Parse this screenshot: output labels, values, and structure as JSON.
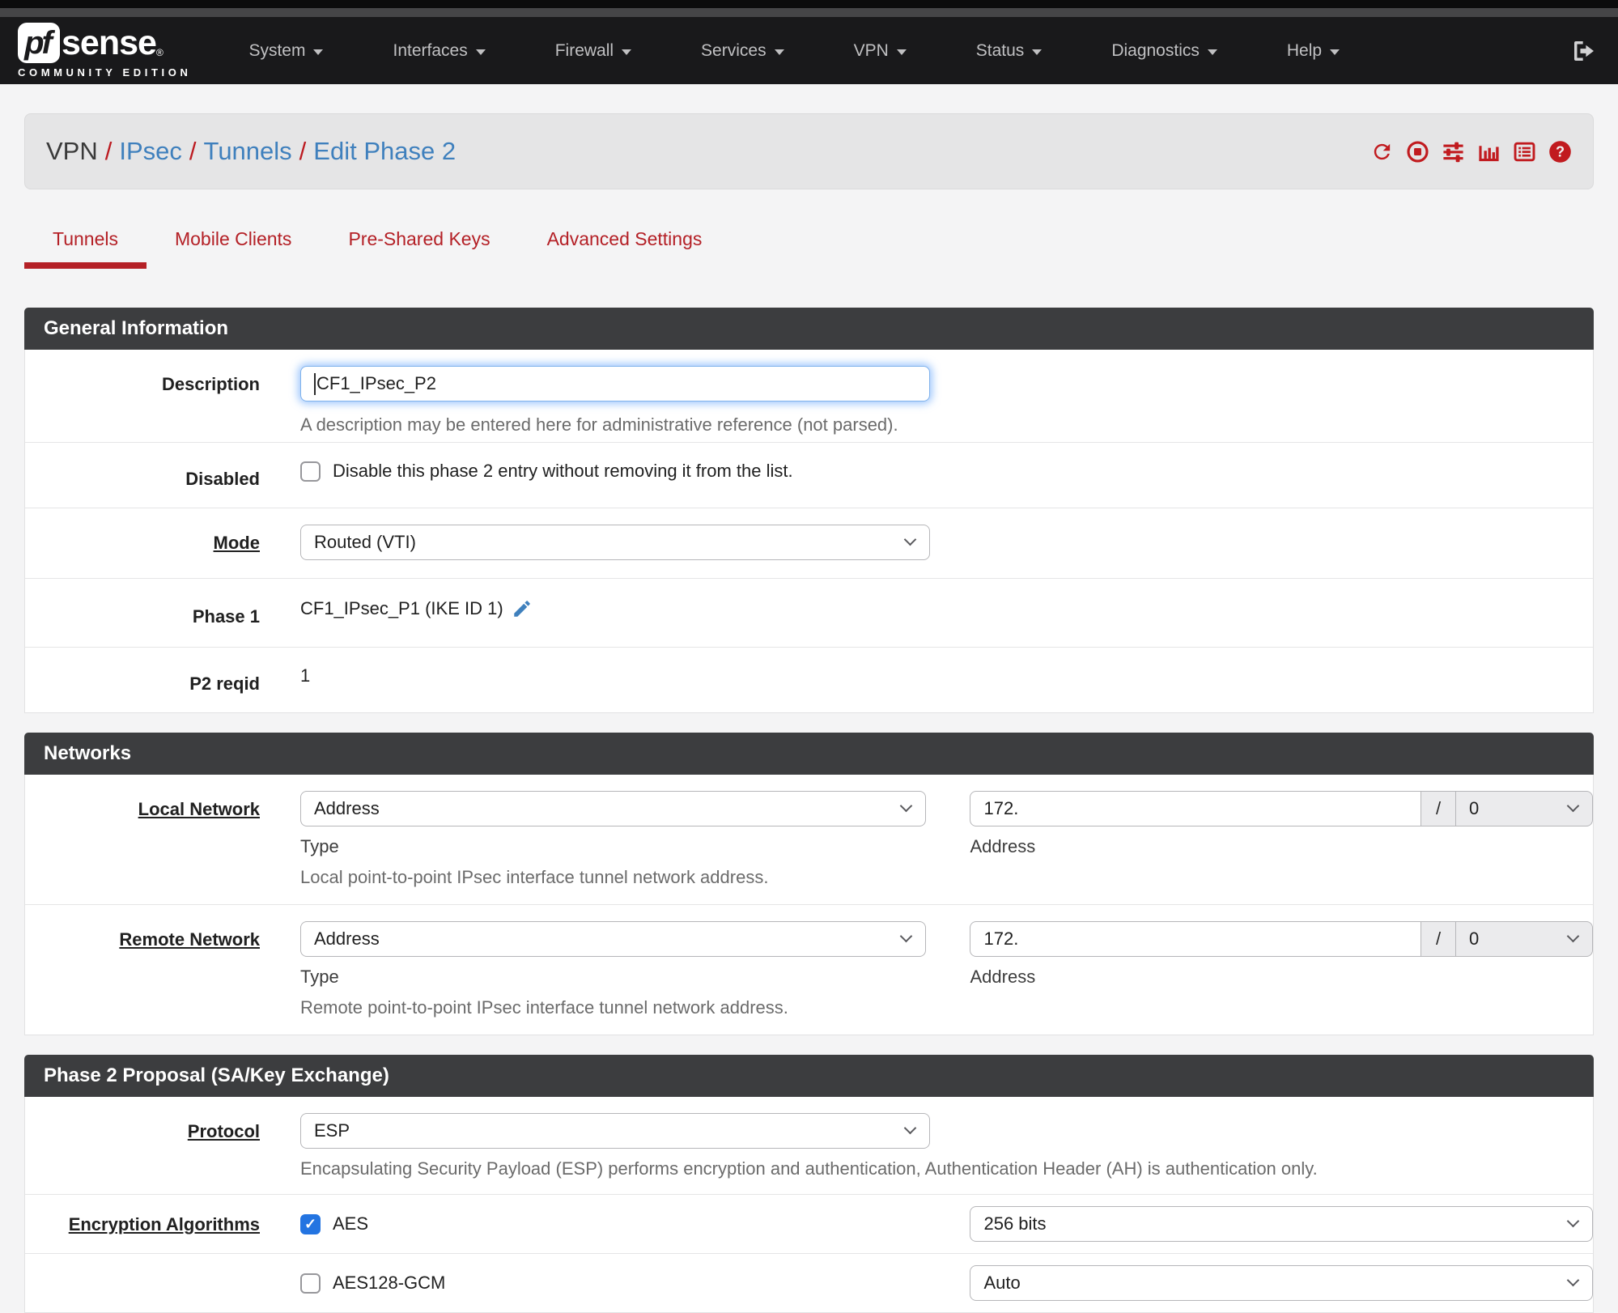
{
  "brand": {
    "logo_pf": "pf",
    "logo_rest": "sense",
    "registered": "®",
    "edition": "COMMUNITY EDITION"
  },
  "navbar": {
    "items": [
      {
        "label": "System"
      },
      {
        "label": "Interfaces"
      },
      {
        "label": "Firewall"
      },
      {
        "label": "Services"
      },
      {
        "label": "VPN"
      },
      {
        "label": "Status"
      },
      {
        "label": "Diagnostics"
      },
      {
        "label": "Help"
      }
    ]
  },
  "breadcrumb": {
    "root": "VPN",
    "separator": "/",
    "link1": "IPsec",
    "link2": "Tunnels",
    "link3": "Edit Phase 2"
  },
  "header_actions": [
    "refresh-icon",
    "stop-circle-icon",
    "sliders-icon",
    "bar-chart-icon",
    "list-icon",
    "question-circle-icon"
  ],
  "tabs": [
    {
      "label": "Tunnels",
      "active": true
    },
    {
      "label": "Mobile Clients",
      "active": false
    },
    {
      "label": "Pre-Shared Keys",
      "active": false
    },
    {
      "label": "Advanced Settings",
      "active": false
    }
  ],
  "colors": {
    "accent_red": "#bc1a20",
    "link_blue": "#3f80bd",
    "panel_header_bg": "#3c3d3f",
    "navbar_bg": "#19191b",
    "checkbox_checked_blue": "#2374e1"
  },
  "general": {
    "title": "General Information",
    "description": {
      "label": "Description",
      "value": "CF1_IPsec_P2",
      "help": "A description may be entered here for administrative reference (not parsed)."
    },
    "disabled": {
      "label": "Disabled",
      "checkbox_label": "Disable this phase 2 entry without removing it from the list.",
      "checked": false
    },
    "mode": {
      "label": "Mode",
      "value": "Routed (VTI)"
    },
    "phase1": {
      "label": "Phase 1",
      "value": "CF1_IPsec_P1 (IKE ID 1)"
    },
    "p2reqid": {
      "label": "P2 reqid",
      "value": "1"
    }
  },
  "networks": {
    "title": "Networks",
    "local": {
      "label": "Local Network",
      "type_value": "Address",
      "type_caption": "Type",
      "address_value": "172.",
      "address_caption": "Address",
      "mask_separator": "/",
      "mask_value": "0",
      "help": "Local point-to-point IPsec interface tunnel network address."
    },
    "remote": {
      "label": "Remote Network",
      "type_value": "Address",
      "type_caption": "Type",
      "address_value": "172.",
      "address_caption": "Address",
      "mask_separator": "/",
      "mask_value": "0",
      "help": "Remote point-to-point IPsec interface tunnel network address."
    }
  },
  "proposal": {
    "title": "Phase 2 Proposal (SA/Key Exchange)",
    "protocol": {
      "label": "Protocol",
      "value": "ESP",
      "help": "Encapsulating Security Payload (ESP) performs encryption and authentication, Authentication Header (AH) is authentication only."
    },
    "encryption": {
      "label": "Encryption Algorithms",
      "algorithms": [
        {
          "name": "AES",
          "checked": true,
          "bits": "256 bits"
        },
        {
          "name": "AES128-GCM",
          "checked": false,
          "bits": "Auto"
        }
      ]
    }
  }
}
